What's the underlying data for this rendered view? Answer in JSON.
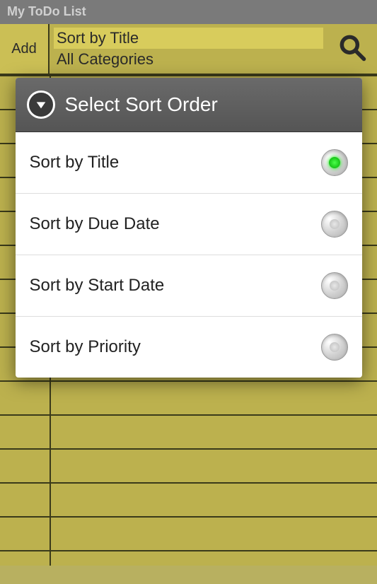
{
  "title_bar": "My ToDo List",
  "toolbar": {
    "add_label": "Add",
    "sort_label": "Sort by Title",
    "category_label": "All Categories"
  },
  "dialog": {
    "title": "Select Sort Order",
    "options": [
      {
        "label": "Sort by Title",
        "selected": true
      },
      {
        "label": "Sort by Due Date",
        "selected": false
      },
      {
        "label": "Sort by Start Date",
        "selected": false
      },
      {
        "label": "Sort by Priority",
        "selected": false
      }
    ]
  }
}
